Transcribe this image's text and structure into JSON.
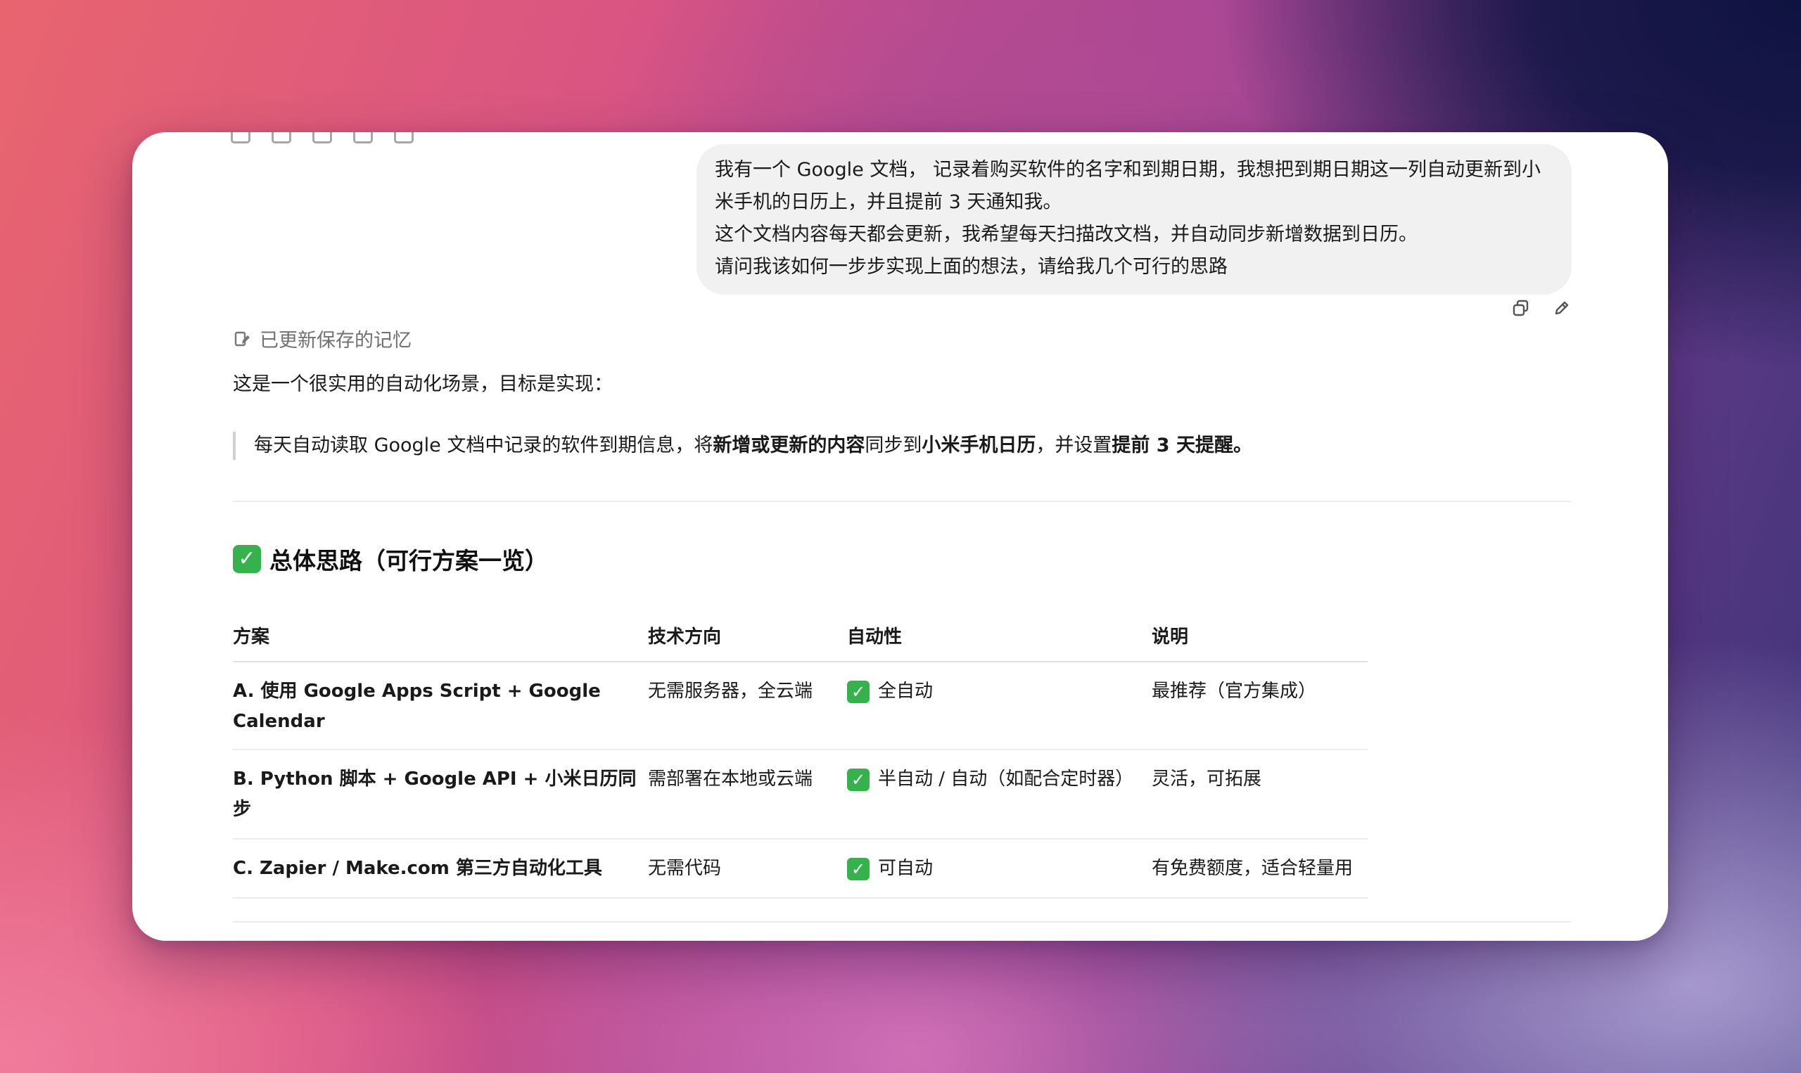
{
  "user_message": {
    "lines": [
      "我有一个 Google 文档， 记录着购买软件的名字和到期日期，我想把到期日期这一列自动更新到小",
      "米手机的日历上，并且提前 3 天通知我。",
      "这个文档内容每天都会更新，我希望每天扫描改文档，并自动同步新增数据到日历。",
      "请问我该如何一步步实现上面的想法，请给我几个可行的思路"
    ]
  },
  "memory_label": "已更新保存的记忆",
  "intro": "这是一个很实用的自动化场景，目标是实现：",
  "quote": {
    "p1": "每天自动读取 Google 文档中记录的软件到期信息，将",
    "b1": "新增或更新的内容",
    "p2": "同步到",
    "b2": "小米手机日历",
    "p3": "，并设置",
    "b3": "提前 3 天提醒。"
  },
  "heading": {
    "check": "✓",
    "text": "总体思路（可行方案一览）"
  },
  "table": {
    "headers": [
      "方案",
      "技术方向",
      "自动性",
      "说明"
    ],
    "rows": [
      {
        "plan_line1": "A. 使用 Google Apps Script + Google",
        "plan_line2": "Calendar",
        "tech": "无需服务器，全云端",
        "auto": "全自动",
        "note": "最推荐（官方集成）"
      },
      {
        "plan_line1": "B. Python 脚本 + Google API + 小米日历同步",
        "tech": "需部署在本地或云端",
        "auto": "半自动 / 自动（如配合定时器）",
        "note": "灵活，可拓展"
      },
      {
        "plan_line1": "C. Zapier / Make.com 第三方自动化工具",
        "tech": "无需代码",
        "auto": "可自动",
        "note": "有免费额度，适合轻量用"
      }
    ]
  },
  "icons": {
    "copy": "copy-icon",
    "edit": "edit-icon",
    "memory": "memory-icon",
    "check": "check-mark-icon"
  },
  "colors": {
    "check_green": "#35b24b",
    "bubble_bg": "#f1f1f1",
    "muted_text": "#707070"
  }
}
